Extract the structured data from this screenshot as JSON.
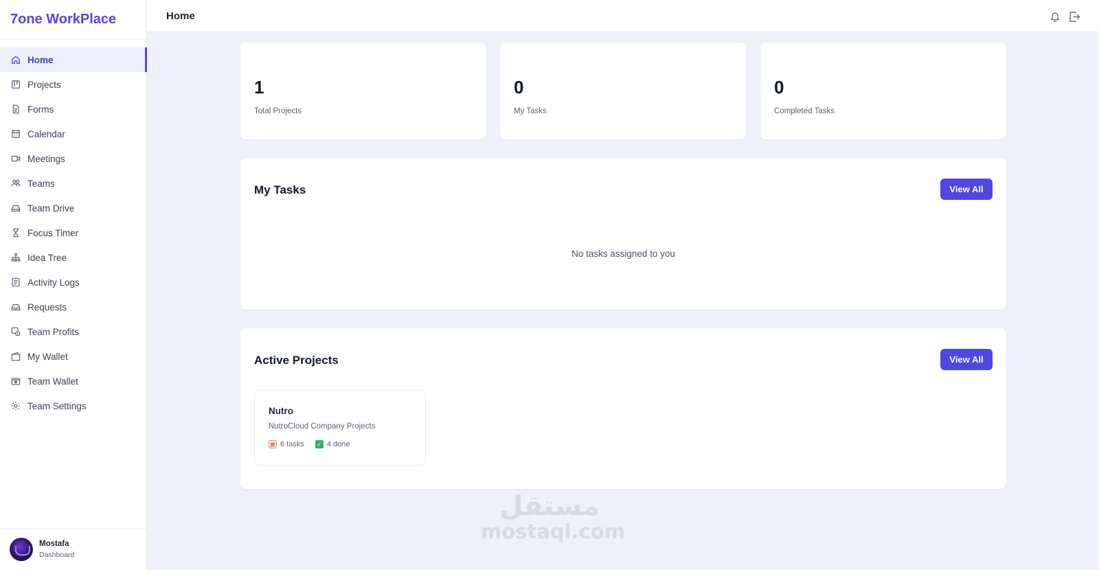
{
  "app": {
    "brand": "7one WorkPlace"
  },
  "sidebar": {
    "items": [
      {
        "label": "Home",
        "icon": "home-icon",
        "active": true
      },
      {
        "label": "Projects",
        "icon": "kanban-icon"
      },
      {
        "label": "Forms",
        "icon": "document-icon"
      },
      {
        "label": "Calendar",
        "icon": "calendar-icon"
      },
      {
        "label": "Meetings",
        "icon": "video-icon"
      },
      {
        "label": "Teams",
        "icon": "users-icon"
      },
      {
        "label": "Team Drive",
        "icon": "drive-icon"
      },
      {
        "label": "Focus Timer",
        "icon": "hourglass-icon"
      },
      {
        "label": "Idea Tree",
        "icon": "tree-icon"
      },
      {
        "label": "Activity Logs",
        "icon": "log-icon"
      },
      {
        "label": "Requests",
        "icon": "inbox-icon"
      },
      {
        "label": "Team Profits",
        "icon": "profits-icon"
      },
      {
        "label": "My Wallet",
        "icon": "wallet-icon"
      },
      {
        "label": "Team Wallet",
        "icon": "team-wallet-icon"
      },
      {
        "label": "Team Settings",
        "icon": "gear-icon"
      }
    ]
  },
  "user": {
    "name": "Mostafa",
    "role": "Dashboard"
  },
  "header": {
    "title": "Home"
  },
  "stats": [
    {
      "value": "1",
      "label": "Total Projects"
    },
    {
      "value": "0",
      "label": "My Tasks"
    },
    {
      "value": "0",
      "label": "Completed Tasks"
    }
  ],
  "my_tasks": {
    "title": "My Tasks",
    "view_all_label": "View All",
    "empty_message": "No tasks assigned to you"
  },
  "active_projects": {
    "title": "Active Projects",
    "view_all_label": "View All",
    "projects": [
      {
        "name": "Nutro",
        "description": "NutroCloud Company Projects",
        "tasks": "6 tasks",
        "done": "4 done"
      }
    ]
  },
  "watermark": {
    "arabic": "مستقل",
    "latin": "mostaql.com"
  },
  "colors": {
    "accent": "#4f46e5",
    "background": "#eef1fb",
    "done": "#2fb36d"
  }
}
